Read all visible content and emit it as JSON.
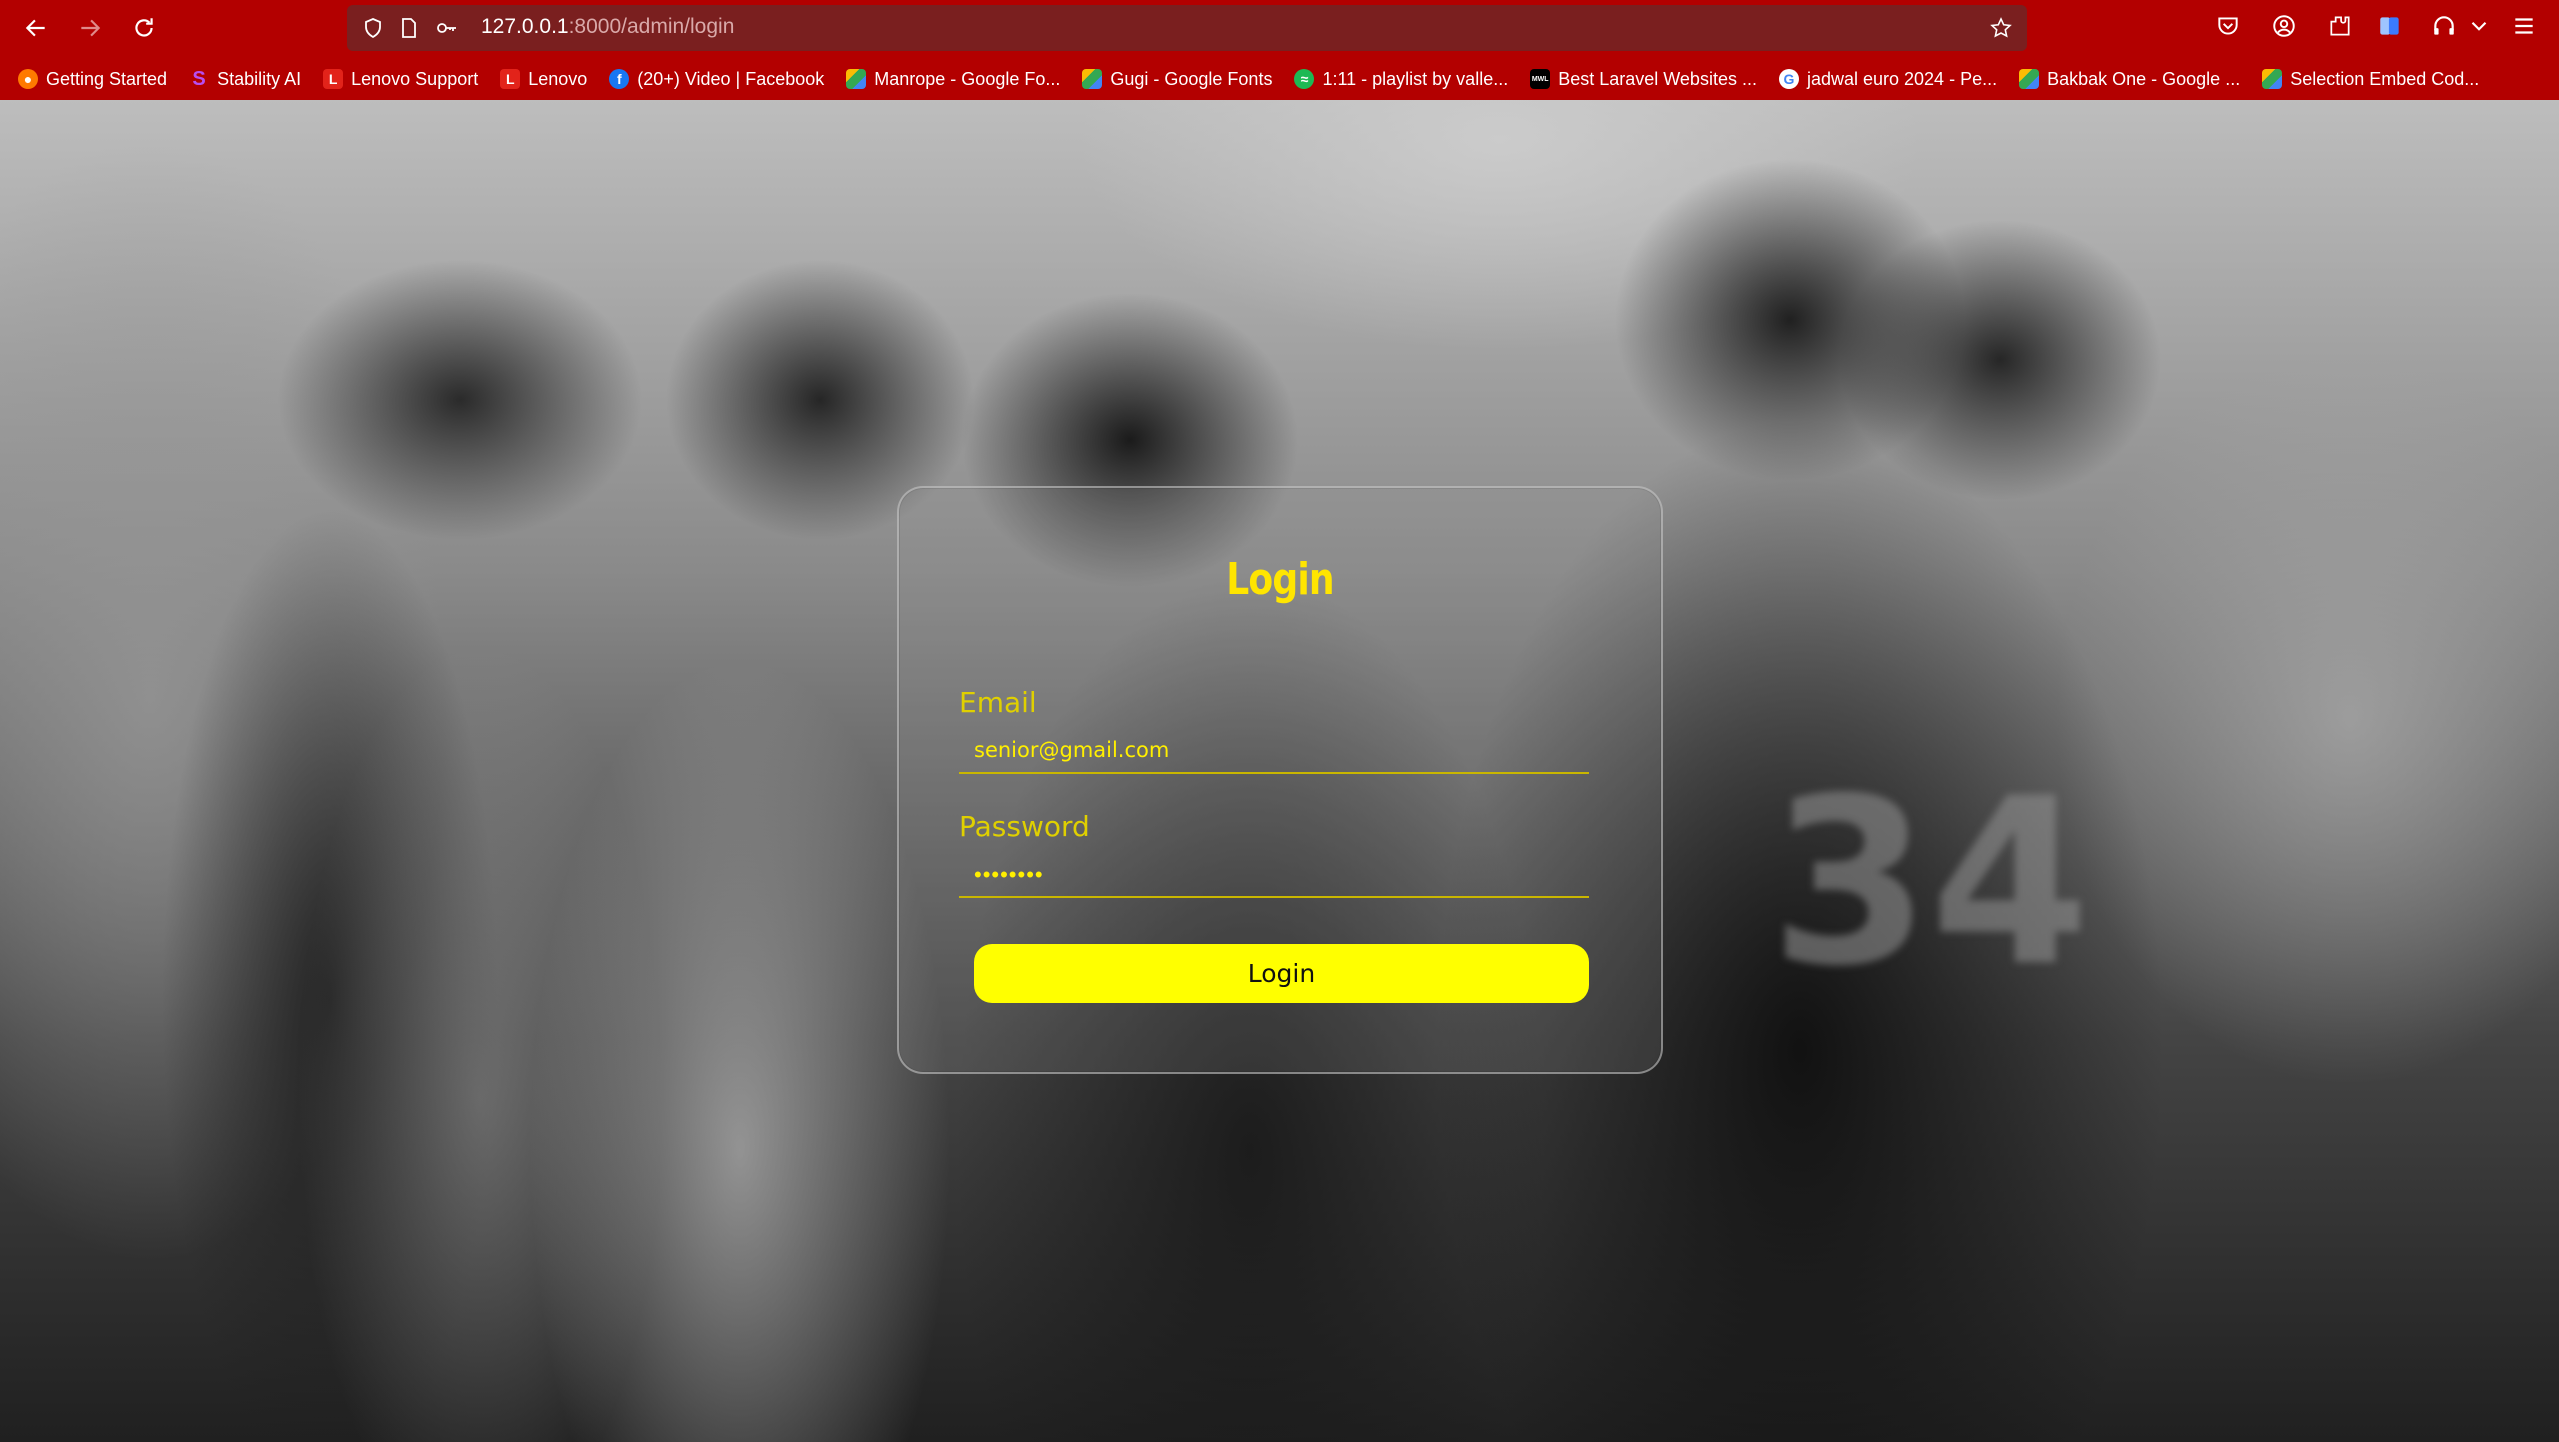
{
  "browser": {
    "url_host": "127.0.0.1",
    "url_rest": ":8000/admin/login",
    "bookmarks": [
      {
        "label": "Getting Started",
        "icon": "firefox-icon",
        "color": "#ff7a00"
      },
      {
        "label": "Stability AI",
        "icon": "stability-icon",
        "color": "#b84ef0"
      },
      {
        "label": "Lenovo Support",
        "icon": "lenovo-icon",
        "color": "#e2231a"
      },
      {
        "label": "Lenovo",
        "icon": "lenovo-icon",
        "color": "#e2231a"
      },
      {
        "label": "(20+) Video | Facebook",
        "icon": "facebook-icon",
        "color": "#1877f2"
      },
      {
        "label": "Manrope - Google Fo...",
        "icon": "google-fonts-icon",
        "color": "#4285f4"
      },
      {
        "label": "Gugi - Google Fonts",
        "icon": "google-fonts-icon",
        "color": "#4285f4"
      },
      {
        "label": "1:11 - playlist by valle...",
        "icon": "spotify-icon",
        "color": "#1db954"
      },
      {
        "label": "Best Laravel Websites ...",
        "icon": "madewithlaravel-icon",
        "color": "#000000"
      },
      {
        "label": "jadwal euro 2024 - Pe...",
        "icon": "google-icon",
        "color": "#ffffff"
      },
      {
        "label": "Bakbak One - Google ...",
        "icon": "google-fonts-icon",
        "color": "#4285f4"
      },
      {
        "label": "Selection Embed Cod...",
        "icon": "google-fonts-icon",
        "color": "#4285f4"
      }
    ]
  },
  "login": {
    "title": "Login",
    "email_label": "Email",
    "email_value": "senior@gmail.com",
    "password_label": "Password",
    "password_mask": "••••••••",
    "button_label": "Login"
  },
  "colors": {
    "accent": "#ffff00",
    "chrome": "#b30000"
  }
}
